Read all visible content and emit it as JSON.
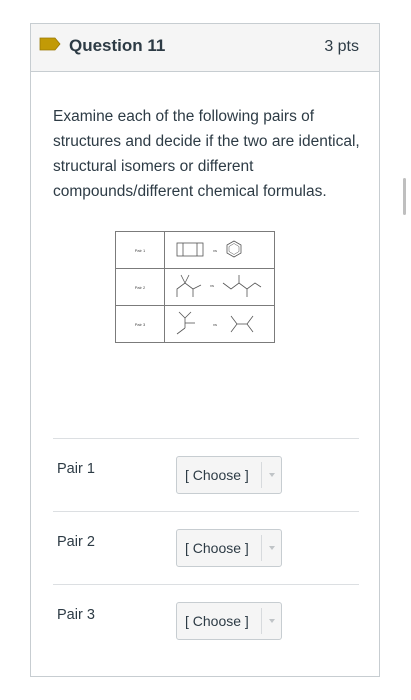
{
  "question": {
    "title": "Question 11",
    "points": "3 pts",
    "text": "Examine each of the following pairs of structures and decide if the two are identical, structural isomers or different compounds/different chemical formulas."
  },
  "figure": {
    "rows": [
      {
        "label": "Pair 1",
        "vs": "vs"
      },
      {
        "label": "Pair 2",
        "vs": "vs"
      },
      {
        "label": "Pair 3",
        "vs": "vs"
      }
    ]
  },
  "answers": [
    {
      "label": "Pair 1",
      "value": "[ Choose ]"
    },
    {
      "label": "Pair 2",
      "value": "[ Choose ]"
    },
    {
      "label": "Pair 3",
      "value": "[ Choose ]"
    }
  ],
  "icons": {
    "flag": "bookmark-flag-icon",
    "dropdown": "caret-down-icon"
  },
  "colors": {
    "flag": "#c29a06",
    "header_bg": "#f5f5f5",
    "border": "#c7cdd1",
    "text": "#2d3b45"
  }
}
